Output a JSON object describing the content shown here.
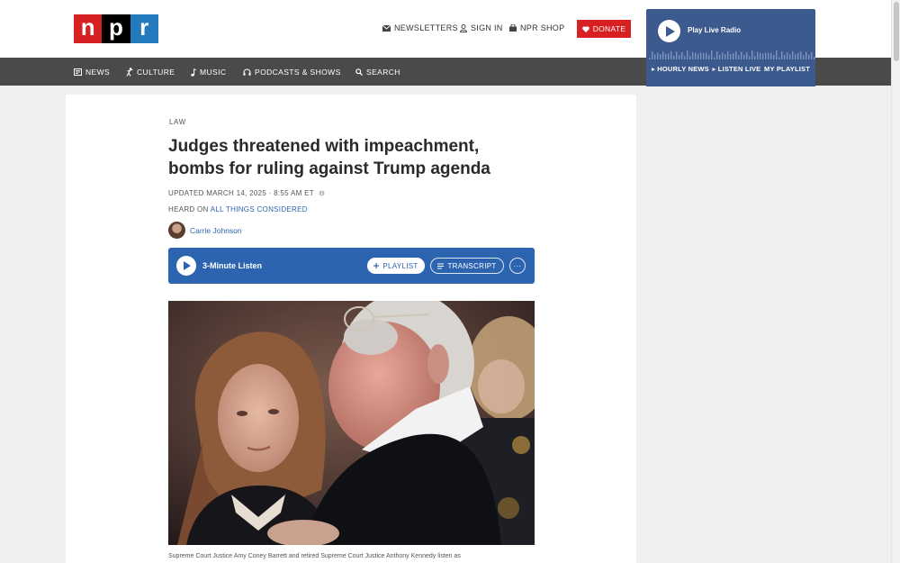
{
  "header": {
    "logo": [
      "n",
      "p",
      "r"
    ],
    "utility": {
      "newsletters": "NEWSLETTERS",
      "sign_in": "SIGN IN",
      "shop": "NPR SHOP"
    },
    "donate": "DONATE"
  },
  "player": {
    "label": "Play Live Radio",
    "links": [
      "▸ HOURLY NEWS",
      "▸ LISTEN LIVE",
      "MY PLAYLIST"
    ]
  },
  "nav": {
    "items": [
      "NEWS",
      "CULTURE",
      "MUSIC",
      "PODCASTS & SHOWS",
      "SEARCH"
    ]
  },
  "article": {
    "section": "LAW",
    "headline": "Judges threatened with impeachment, bombs for ruling against Trump agenda",
    "updated": "UPDATED MARCH 14, 2025 · 8:55 AM ET",
    "heard_on_prefix": "HEARD ON ",
    "heard_on_program": "ALL THINGS CONSIDERED",
    "author": "Carrie Johnson",
    "audio": {
      "label": "3-Minute Listen",
      "playlist": "PLAYLIST",
      "transcript": "TRANSCRIPT",
      "more": "···"
    },
    "caption": "Supreme Court Justice Amy Coney Barrett and retired Supreme Court Justice Anthony Kennedy listen as"
  },
  "colors": {
    "npr_red": "#d62021",
    "npr_black": "#000000",
    "npr_blue": "#237bbd",
    "nav_gray": "#4a4a4a",
    "player_blue": "#3d5a8e",
    "audio_blue": "#2d64b0",
    "link_blue": "#2f63b0"
  },
  "icons": {
    "newsletters": "envelope-icon",
    "sign_in": "user-icon",
    "shop": "shopping-bag-icon",
    "donate": "heart-icon",
    "news": "newspaper-icon",
    "culture": "dancer-icon",
    "music": "music-note-icon",
    "podcasts": "headphones-icon",
    "search": "search-icon"
  }
}
